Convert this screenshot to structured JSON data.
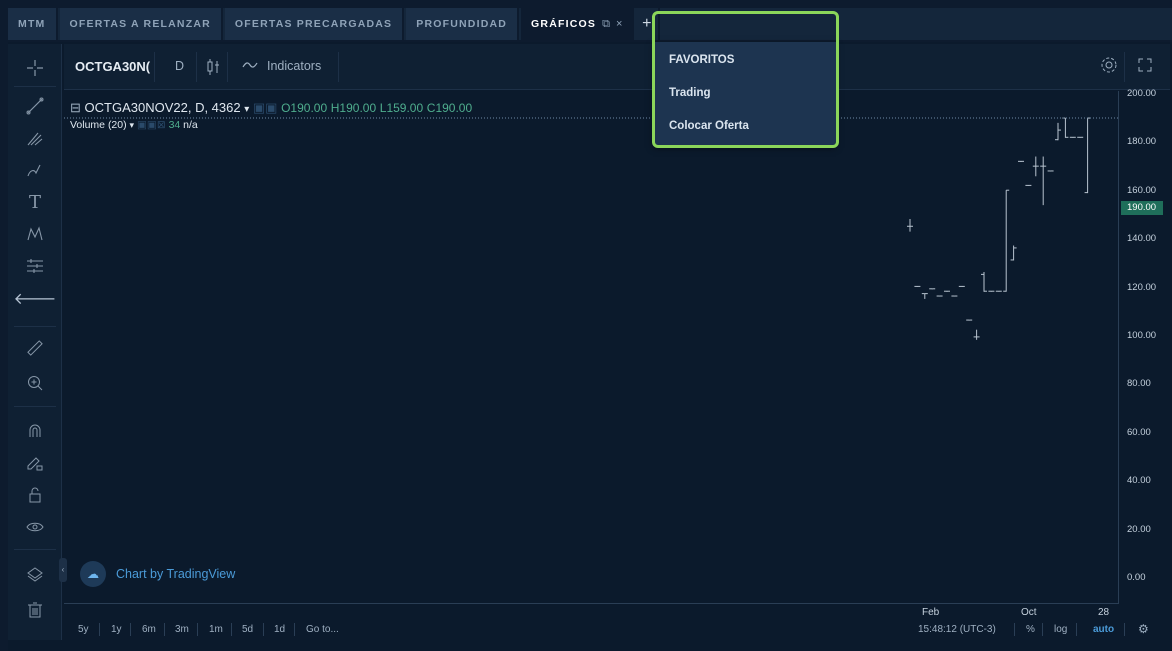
{
  "tabs": [
    {
      "label": "MTM"
    },
    {
      "label": "OFERTAS A RELANZAR"
    },
    {
      "label": "OFERTAS PRECARGADAS"
    },
    {
      "label": "PROFUNDIDAD"
    },
    {
      "label": "GRÁFICOS",
      "active": true
    }
  ],
  "tab_plus": "+",
  "dropdown": {
    "items": [
      "FAVORITOS",
      "Trading",
      "Colocar Oferta"
    ]
  },
  "toolbar": {
    "symbol": "OCTGA30N(",
    "interval": "D",
    "indicators": "Indicators"
  },
  "legend": {
    "title": "OCTGA30NOV22, D, 4362",
    "open": "O190.00",
    "high": "H190.00",
    "low": "L159.00",
    "close": "C190.00",
    "volume_label": "Volume (20)",
    "volume_value": "34",
    "volume_extra": "n/a"
  },
  "watermark": "Chart by TradingView",
  "price_axis": {
    "labels": [
      "200.00",
      "180.00",
      "160.00",
      "140.00",
      "120.00",
      "100.00",
      "80.00",
      "60.00",
      "40.00",
      "20.00",
      "0.00"
    ],
    "last_price": "190.00"
  },
  "time_axis": [
    "Feb",
    "Oct",
    "28"
  ],
  "bottom_bar": {
    "ranges": [
      "5y",
      "1y",
      "6m",
      "3m",
      "1m",
      "5d",
      "1d"
    ],
    "goto": "Go to...",
    "clock": "15:48:12 (UTC-3)",
    "percent": "%",
    "log": "log",
    "auto": "auto"
  },
  "colors": {
    "accent_green": "#8bd65a",
    "candle": "#b8c4d0",
    "volume_bar": "#3f7a68"
  },
  "chart_data": {
    "type": "bar",
    "categories": [],
    "ylim": [
      0,
      200
    ],
    "price_bars": [
      {
        "o": 145,
        "h": 148,
        "l": 143,
        "c": 145
      },
      {
        "o": 120,
        "h": 120,
        "l": 120,
        "c": 120
      },
      {
        "o": 117,
        "h": 117,
        "l": 115,
        "c": 117
      },
      {
        "o": 119,
        "h": 119,
        "l": 119,
        "c": 119
      },
      {
        "o": 116,
        "h": 116,
        "l": 116,
        "c": 116
      },
      {
        "o": 118,
        "h": 118,
        "l": 118,
        "c": 118
      },
      {
        "o": 116,
        "h": 116,
        "l": 116,
        "c": 116
      },
      {
        "o": 120,
        "h": 120,
        "l": 120,
        "c": 120
      },
      {
        "o": 106,
        "h": 106,
        "l": 106,
        "c": 106
      },
      {
        "o": 99,
        "h": 102,
        "l": 98,
        "c": 99
      },
      {
        "o": 125,
        "h": 126,
        "l": 118,
        "c": 118
      },
      {
        "o": 118,
        "h": 118,
        "l": 118,
        "c": 118
      },
      {
        "o": 118,
        "h": 118,
        "l": 118,
        "c": 118
      },
      {
        "o": 118,
        "h": 160,
        "l": 118,
        "c": 160
      },
      {
        "o": 131,
        "h": 137,
        "l": 131,
        "c": 136
      },
      {
        "o": 172,
        "h": 172,
        "l": 172,
        "c": 172
      },
      {
        "o": 162,
        "h": 162,
        "l": 162,
        "c": 162
      },
      {
        "o": 170,
        "h": 174,
        "l": 166,
        "c": 170
      },
      {
        "o": 170,
        "h": 174,
        "l": 154,
        "c": 170
      },
      {
        "o": 168,
        "h": 168,
        "l": 168,
        "c": 168
      },
      {
        "o": 181,
        "h": 188,
        "l": 181,
        "c": 185
      },
      {
        "o": 190,
        "h": 190,
        "l": 182,
        "c": 182
      },
      {
        "o": 182,
        "h": 182,
        "l": 182,
        "c": 182
      },
      {
        "o": 182,
        "h": 182,
        "l": 182,
        "c": 182
      },
      {
        "o": 159,
        "h": 190,
        "l": 159,
        "c": 190
      }
    ]
  }
}
